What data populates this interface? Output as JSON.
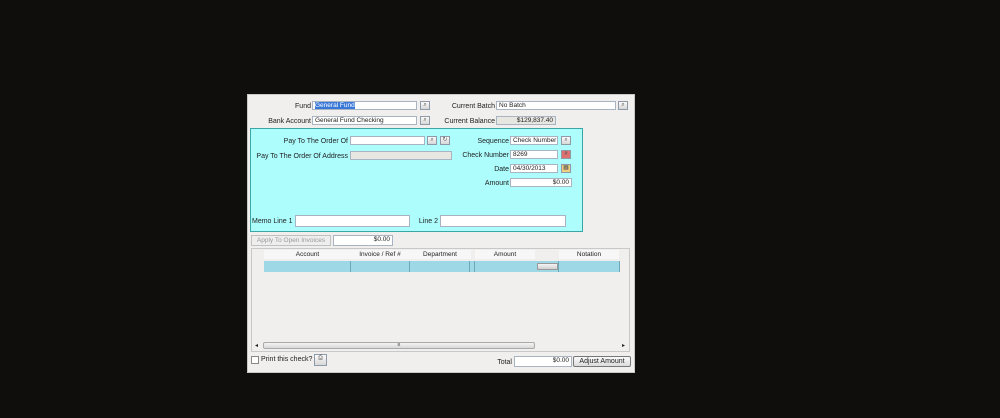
{
  "header": {
    "fund_label": "Fund",
    "fund_value": "General Fund",
    "bank_account_label": "Bank Account",
    "bank_account_value": "General Fund Checking",
    "current_batch_label": "Current Batch",
    "current_batch_value": "No Batch",
    "current_balance_label": "Current Balance",
    "current_balance_value": "$129,837.40"
  },
  "check": {
    "pay_to_label": "Pay To The Order Of",
    "pay_to_value": "",
    "pay_to_address_label": "Pay To The Order Of Address",
    "pay_to_address_value": "",
    "sequence_label": "Sequence",
    "sequence_value": "Check Number",
    "check_number_label": "Check Number",
    "check_number_value": "8269",
    "date_label": "Date",
    "date_value": "04/30/2013",
    "amount_label": "Amount",
    "amount_value": "$0.00",
    "memo1_label": "Memo Line 1",
    "memo1_value": "",
    "line2_label": "Line 2",
    "line2_value": ""
  },
  "apply": {
    "button_label": "Apply To Open Invoices",
    "amount": "$0.00"
  },
  "grid": {
    "columns": [
      "Account",
      "Invoice / Ref #",
      "Department",
      "Amount",
      "Notation"
    ]
  },
  "footer": {
    "print_label": "Print this check?",
    "print_checked": false,
    "total_label": "Total",
    "total_value": "$0.00",
    "adjust_label": "Adjust Amount"
  },
  "colors": {
    "panel": "#adfdfd",
    "grid_row": "#9ed8e6",
    "selection": "#3a78d8"
  }
}
